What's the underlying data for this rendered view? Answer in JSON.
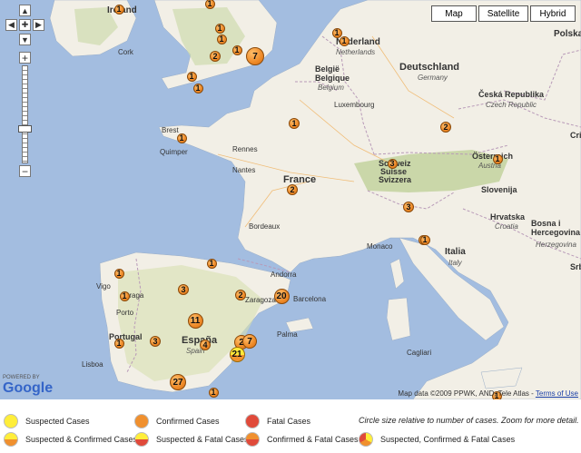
{
  "map_types": [
    "Map",
    "Satellite",
    "Hybrid"
  ],
  "countries": [
    {
      "name": "Ireland"
    },
    {
      "name": "Nederland"
    },
    {
      "name": "Deutschland"
    },
    {
      "name": "België"
    },
    {
      "name": "Luxembourg"
    },
    {
      "name": "France"
    },
    {
      "name": "Česká Republika"
    },
    {
      "name": "Schweiz"
    },
    {
      "name": "Österreich"
    },
    {
      "name": "Slovenija"
    },
    {
      "name": "Hrvatska"
    },
    {
      "name": "Bosna i Hercegovina"
    },
    {
      "name": "Italia"
    },
    {
      "name": "Portugal"
    },
    {
      "name": "España"
    },
    {
      "name": "Andorra"
    },
    {
      "name": "Monaco"
    },
    {
      "name": "Polska"
    }
  ],
  "subtitles": [
    "Netherlands",
    "Belgique",
    "Belgium",
    "Germany",
    "Czech Republic",
    "Suisse",
    "Svizzera",
    "Austria",
    "Croatia",
    "Italy",
    "Spain",
    "Herzegovina"
  ],
  "cities": [
    "Cork",
    "Brest",
    "Quimper",
    "Rennes",
    "Nantes",
    "Bordeaux",
    "Zaragoza",
    "Barcelona",
    "Vigo",
    "Braga",
    "Porto",
    "Lisboa",
    "Palma",
    "Cagliari",
    "Srbij",
    "Cri"
  ],
  "markers": [
    {
      "label": "1",
      "type": "confirmed"
    },
    {
      "label": "1",
      "type": "confirmed"
    },
    {
      "label": "1",
      "type": "confirmed"
    },
    {
      "label": "1",
      "type": "confirmed"
    },
    {
      "label": "2",
      "type": "confirmed"
    },
    {
      "label": "1",
      "type": "confirmed"
    },
    {
      "label": "7",
      "type": "confirmed"
    },
    {
      "label": "1",
      "type": "confirmed"
    },
    {
      "label": "1",
      "type": "confirmed"
    },
    {
      "label": "1",
      "type": "confirmed"
    },
    {
      "label": "1",
      "type": "confirmed"
    },
    {
      "label": "1",
      "type": "confirmed"
    },
    {
      "label": "1",
      "type": "confirmed"
    },
    {
      "label": "2",
      "type": "confirmed"
    },
    {
      "label": "2",
      "type": "confirmed"
    },
    {
      "label": "3",
      "type": "confirmed"
    },
    {
      "label": "1",
      "type": "confirmed"
    },
    {
      "label": "1",
      "type": "confirmed"
    },
    {
      "label": "3",
      "type": "confirmed"
    },
    {
      "label": "1",
      "type": "confirmed"
    },
    {
      "label": "1",
      "type": "confirmed"
    },
    {
      "label": "1",
      "type": "confirmed"
    },
    {
      "label": "1",
      "type": "confirmed"
    },
    {
      "label": "3",
      "type": "confirmed"
    },
    {
      "label": "2",
      "type": "confirmed"
    },
    {
      "label": "20",
      "type": "confirmed"
    },
    {
      "label": "11",
      "type": "confirmed"
    },
    {
      "label": "3",
      "type": "confirmed"
    },
    {
      "label": "1",
      "type": "confirmed"
    },
    {
      "label": "4",
      "type": "confirmed"
    },
    {
      "label": "2",
      "type": "confirmed"
    },
    {
      "label": "7",
      "type": "confirmed"
    },
    {
      "label": "21",
      "type": "suspected_confirmed"
    },
    {
      "label": "1",
      "type": "confirmed"
    },
    {
      "label": "27",
      "type": "confirmed"
    },
    {
      "label": "1",
      "type": "confirmed"
    }
  ],
  "attribution": {
    "text": "Map data ©2009 PPWK, AND, Tele Atlas -",
    "link": "Terms of Use"
  },
  "powered_by": "POWERED BY",
  "google": "Google",
  "legend": {
    "items": [
      {
        "label": "Suspected Cases",
        "kind": "suspected"
      },
      {
        "label": "Confirmed Cases",
        "kind": "confirmed"
      },
      {
        "label": "Fatal Cases",
        "kind": "fatal"
      },
      {
        "label": "Suspected & Confirmed Cases",
        "kind": "suspected_confirmed"
      },
      {
        "label": "Suspected & Fatal Cases",
        "kind": "suspected_fatal"
      },
      {
        "label": "Confirmed & Fatal Cases",
        "kind": "confirmed_fatal"
      },
      {
        "label": "Suspected, Confirmed & Fatal Cases",
        "kind": "all"
      }
    ],
    "note": "Circle size relative to number of cases. Zoom for more detail."
  },
  "colors": {
    "sea": "#a3bde0",
    "land": "#f2efe6",
    "land_green": "#c8d8a4",
    "confirmed": "#f0902e",
    "suspected": "#ffee3a",
    "fatal": "#e04a3a"
  }
}
